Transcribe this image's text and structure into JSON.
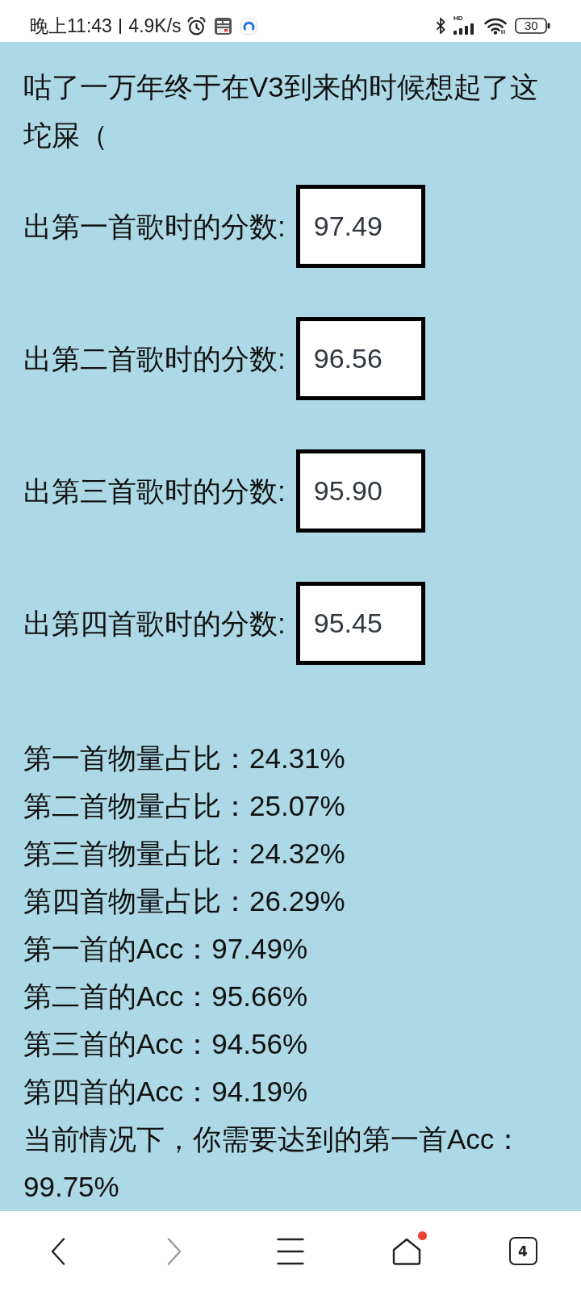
{
  "status_bar": {
    "time": "晚上11:43",
    "net_speed": "4.9K/s",
    "network_type": "HD",
    "battery": "30"
  },
  "intro": "咕了一万年终于在V3到来的时候想起了这坨屎（",
  "score_fields": [
    {
      "label": "出第一首歌时的分数:",
      "value": "97.49"
    },
    {
      "label": "出第二首歌时的分数:",
      "value": "96.56"
    },
    {
      "label": "出第三首歌时的分数:",
      "value": "95.90"
    },
    {
      "label": "出第四首歌时的分数:",
      "value": "95.45"
    }
  ],
  "results": [
    "第一首物量占比：24.31%",
    "第二首物量占比：25.07%",
    "第三首物量占比：24.32%",
    "第四首物量占比：26.29%",
    "第一首的Acc：97.49%",
    "第二首的Acc：95.66%",
    "第三首的Acc：94.56%",
    "第四首的Acc：94.19%",
    "当前情况下，你需要达到的第一首Acc：99.75%"
  ],
  "bottom_nav": [
    {
      "kind": "back",
      "disabled": false,
      "dot": false
    },
    {
      "kind": "forward",
      "disabled": true,
      "dot": false
    },
    {
      "kind": "menu",
      "disabled": false,
      "dot": false
    },
    {
      "kind": "home",
      "disabled": false,
      "dot": true
    },
    {
      "kind": "tabs",
      "disabled": false,
      "dot": false,
      "count": "4"
    }
  ]
}
